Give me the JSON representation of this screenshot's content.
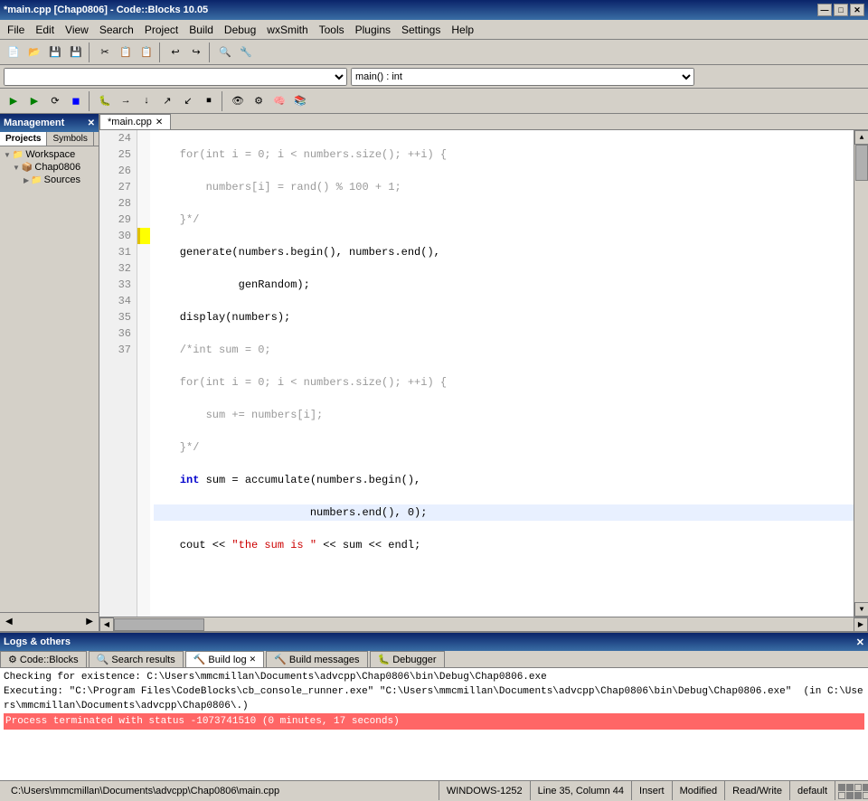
{
  "titlebar": {
    "title": "*main.cpp [Chap0806] - Code::Blocks 10.05",
    "buttons": [
      "—",
      "□",
      "✕"
    ]
  },
  "menubar": {
    "items": [
      "File",
      "Edit",
      "View",
      "Search",
      "Project",
      "Build",
      "Debug",
      "wxSmith",
      "Tools",
      "Plugins",
      "Settings",
      "Help"
    ]
  },
  "toolbar1": {
    "buttons": [
      "📄",
      "📂",
      "💾",
      "💾",
      "⚙",
      "✂",
      "📋",
      "📋",
      "↩",
      "↪",
      "🔍",
      "🔧"
    ]
  },
  "funcbar": {
    "left_placeholder": "",
    "right_value": "main() : int"
  },
  "toolbar2": {
    "buttons": [
      "▶",
      "⏹",
      "⟳",
      "🐛",
      "◼",
      "⬛",
      "□",
      "○",
      "→",
      "↓",
      "↑",
      "🔄",
      "←",
      "⏸",
      "▶"
    ]
  },
  "left_panel": {
    "header": "Management",
    "tabs": [
      "Projects",
      "Symbols"
    ],
    "active_tab": "Projects",
    "tree": [
      {
        "label": "Workspace",
        "level": 0,
        "icon": "📁",
        "arrow": "▼"
      },
      {
        "label": "Chap0806",
        "level": 1,
        "icon": "📦",
        "arrow": "▼"
      },
      {
        "label": "Sources",
        "level": 2,
        "icon": "📁",
        "arrow": "▶"
      }
    ]
  },
  "editor": {
    "tab": "*main.cpp",
    "lines": [
      {
        "num": 24,
        "code": "    for(int i = 0; i < numbers.size(); ++i) {",
        "type": "comment"
      },
      {
        "num": 25,
        "code": "        numbers[i] = rand() % 100 + 1;",
        "type": "comment"
      },
      {
        "num": 26,
        "code": "    }*/",
        "type": "comment"
      },
      {
        "num": 27,
        "code": "    generate(numbers.begin(), numbers.end(),",
        "type": "normal"
      },
      {
        "num": 28,
        "code": "             genRandom);",
        "type": "normal"
      },
      {
        "num": 29,
        "code": "    display(numbers);",
        "type": "normal"
      },
      {
        "num": 30,
        "code": "    /*int sum = 0;",
        "type": "comment",
        "has_marker": true
      },
      {
        "num": 31,
        "code": "    for(int i = 0; i < numbers.size(); ++i) {",
        "type": "comment"
      },
      {
        "num": 32,
        "code": "        sum += numbers[i];",
        "type": "comment"
      },
      {
        "num": 33,
        "code": "    }*/",
        "type": "comment"
      },
      {
        "num": 34,
        "code": "    int sum = accumulate(numbers.begin(),",
        "type": "normal"
      },
      {
        "num": 35,
        "code": "                        numbers.end(), 0);",
        "type": "normal",
        "current": true
      },
      {
        "num": 36,
        "code": "    cout << \"the sum is \" << sum << endl;",
        "type": "normal"
      },
      {
        "num": 37,
        "code": "",
        "type": "normal"
      }
    ]
  },
  "logs": {
    "header": "Logs & others",
    "tabs": [
      {
        "label": "Code::Blocks",
        "icon": "⚙",
        "active": false,
        "closable": false
      },
      {
        "label": "Search results",
        "icon": "🔍",
        "active": false,
        "closable": false
      },
      {
        "label": "Build log",
        "icon": "🔨",
        "active": true,
        "closable": true
      },
      {
        "label": "Build messages",
        "icon": "🔨",
        "active": false,
        "closable": false
      },
      {
        "label": "Debugger",
        "icon": "🐛",
        "active": false,
        "closable": false
      }
    ],
    "lines": [
      {
        "text": "Checking for existence: C:\\Users\\mmcmillan\\Documents\\advcpp\\Chap0806\\bin\\Debug\\Chap0806.exe",
        "type": "normal"
      },
      {
        "text": "Executing: \"C:\\Program Files\\CodeBlocks\\cb_console_runner.exe\" \"C:\\Users\\mmcmillan\\Documents\\advcpp\\Chap0806\\bin\\Debug\\Chap0806.exe\"  (in C:\\Users\\mmcmillan\\Documents\\advcpp\\Chap0806\\.)",
        "type": "normal"
      },
      {
        "text": "Process terminated with status -1073741510 (0 minutes, 17 seconds)",
        "type": "error"
      }
    ]
  },
  "statusbar": {
    "filepath": "C:\\Users\\mmcmillan\\Documents\\advcpp\\Chap0806\\main.cpp",
    "encoding": "WINDOWS-1252",
    "position": "Line 35, Column 44",
    "insert_mode": "Insert",
    "modified": "Modified",
    "readwrite": "Read/Write",
    "default": "default"
  }
}
